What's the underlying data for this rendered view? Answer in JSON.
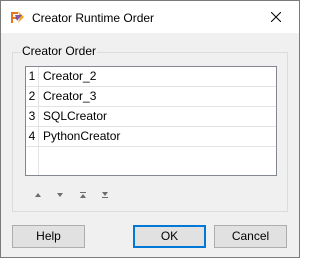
{
  "window": {
    "title": "Creator Runtime Order",
    "icons": {
      "app": "fme-logo-icon",
      "close": "close-icon"
    }
  },
  "group": {
    "label": "Creator Order"
  },
  "list": {
    "rows": [
      {
        "index": "1",
        "name": "Creator_2"
      },
      {
        "index": "2",
        "name": "Creator_3"
      },
      {
        "index": "3",
        "name": "SQLCreator"
      },
      {
        "index": "4",
        "name": "PythonCreator"
      }
    ]
  },
  "order_controls": {
    "icons": [
      "move-up-icon",
      "move-down-icon",
      "move-to-top-icon",
      "move-to-bottom-icon"
    ]
  },
  "buttons": {
    "help": "Help",
    "ok": "OK",
    "cancel": "Cancel"
  },
  "colors": {
    "window_bg": "#f0f0f0",
    "titlebar_bg": "#ffffff",
    "list_bg": "#ffffff",
    "default_button_border": "#0078d7",
    "button_bg": "#e1e1e1"
  }
}
